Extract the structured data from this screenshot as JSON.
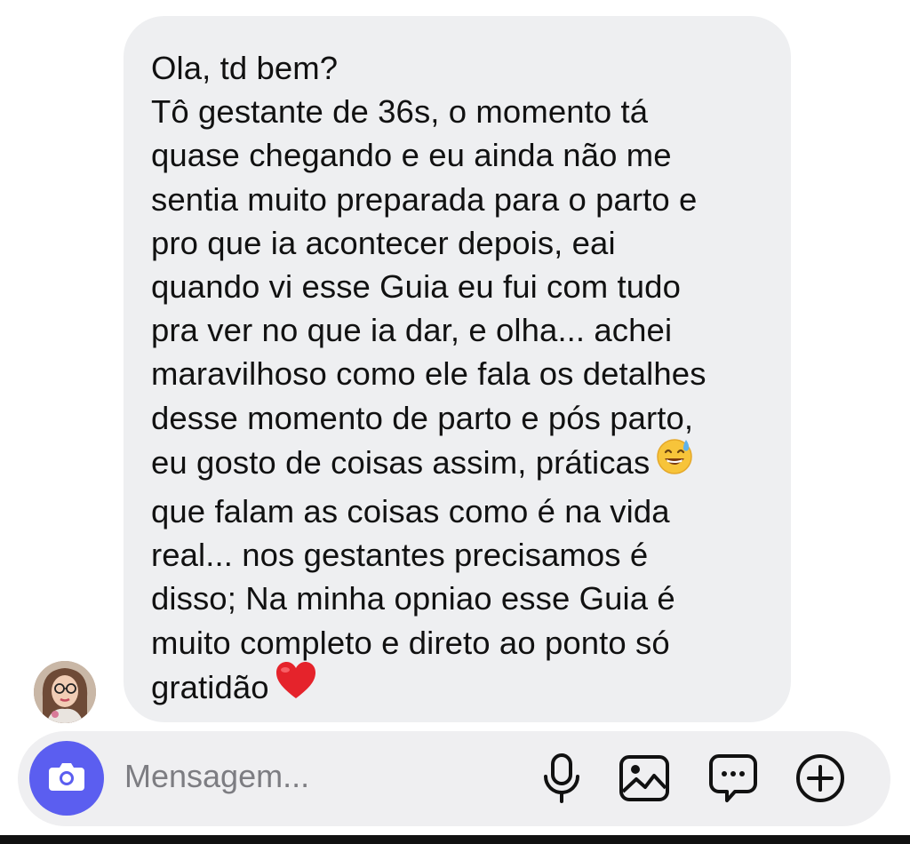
{
  "message": {
    "lines": [
      "Ola, td bem?",
      "Tô gestante de 36s, o momento tá",
      "quase chegando e eu ainda não me",
      "sentia muito preparada para o parto e",
      "pro que ia acontecer depois, eai",
      "quando vi esse Guia eu fui com tudo",
      "pra ver no que ia dar, e olha... achei",
      "maravilhoso como ele fala os detalhes",
      "desse momento de parto e pós parto,",
      "eu gosto de coisas assim, práticas",
      "que falam as coisas como é na vida",
      "real... nos gestantes precisamos é",
      "disso; Na minha opniao esse Guia é",
      "muito completo e direto ao ponto só",
      "gratidão"
    ],
    "emoji_line_10": "grinning-sweat-emoji",
    "emoji_line_15": "red-heart-emoji"
  },
  "composer": {
    "placeholder": "Mensagem...",
    "icons": [
      "camera-icon",
      "microphone-icon",
      "image-icon",
      "sticker-chat-icon",
      "add-icon"
    ]
  },
  "colors": {
    "bubble_bg": "#eeeff1",
    "camera_button": "#5b5ef0",
    "placeholder_text": "#7d7d82"
  }
}
